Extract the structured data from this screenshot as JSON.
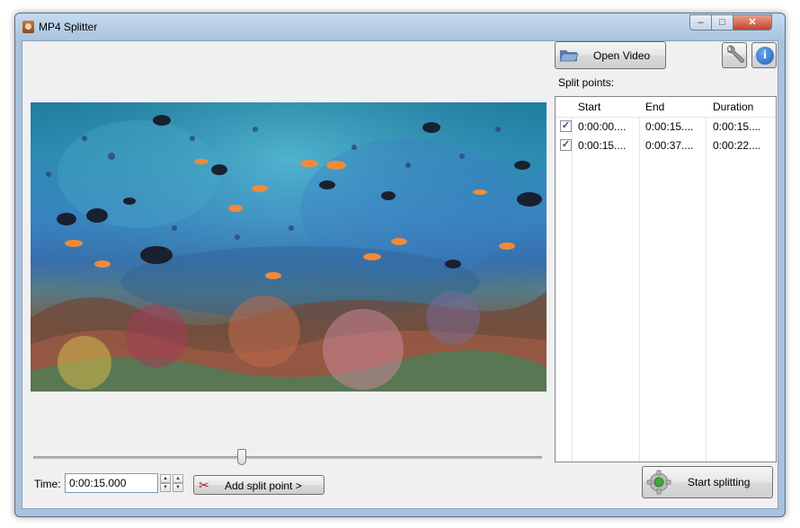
{
  "window": {
    "title": "MP4 Splitter",
    "controls": {
      "minimize": "–",
      "maximize": "□",
      "close": "✕"
    }
  },
  "toolbar": {
    "open_video_label": "Open Video",
    "settings_icon": "wrench-icon",
    "info_icon": "info-icon",
    "info_glyph": "i"
  },
  "split_points": {
    "label": "Split points:",
    "columns": [
      "Start",
      "End",
      "Duration"
    ],
    "rows": [
      {
        "checked": true,
        "start": "0:00:00....",
        "end": "0:00:15....",
        "duration": "0:00:15...."
      },
      {
        "checked": true,
        "start": "0:00:15....",
        "end": "0:00:37....",
        "duration": "0:00:22...."
      }
    ]
  },
  "player": {
    "position_fraction": 0.41,
    "time_label": "Time:",
    "time_value": "0:00:15.000"
  },
  "actions": {
    "add_split_label": "Add split point >",
    "start_splitting_label": "Start splitting"
  },
  "colors": {
    "title_bar": "#a8c3df",
    "close_button": "#c6412b",
    "info_icon": "#1c5fb8"
  }
}
